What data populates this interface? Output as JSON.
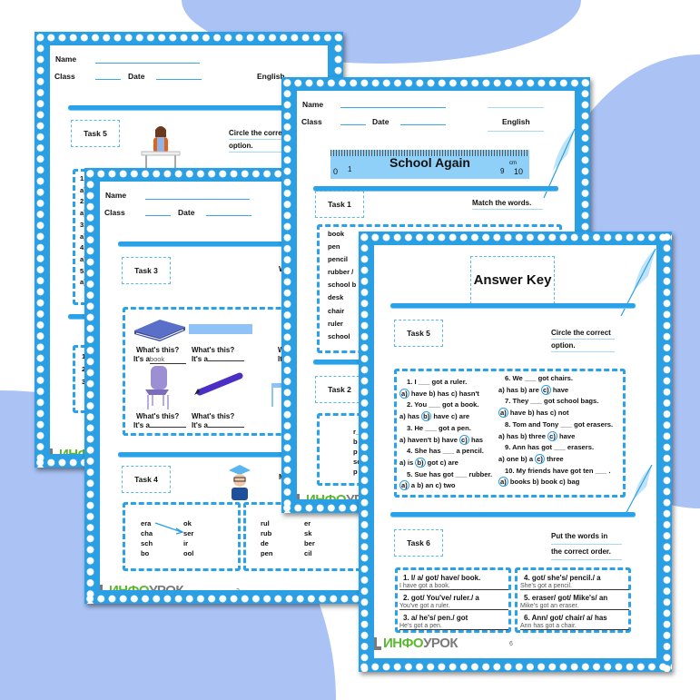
{
  "colors": {
    "border": "#2a9fe4",
    "accent": "#2aa2ea",
    "background_blob": "#aac3f4",
    "logo_green": "#5cb82e",
    "logo_gray": "#7a7a7a"
  },
  "header": {
    "name_label": "Name",
    "class_label": "Class",
    "date_label": "Date",
    "subject": "English"
  },
  "logo": {
    "part1": "ИНФО",
    "part2": "УРОК"
  },
  "page_task5_sheet": {
    "task": "Task 5",
    "instruction": [
      "Circle the correct",
      "option."
    ],
    "items": [
      "1.",
      "a)",
      "2.",
      "a)",
      "3.",
      "a)",
      "4.",
      "a)",
      "5.",
      "a)"
    ],
    "task_below_items": [
      "1",
      "2",
      "3"
    ]
  },
  "page_tasks34": {
    "task3": "Task 3",
    "task3_instruction": "W",
    "pictures": [
      {
        "icon": "book-icon",
        "q": "What's this?",
        "a": "It's a",
        "answer": "book"
      },
      {
        "icon": "ruler-icon",
        "q": "What's this?",
        "a": "It's a",
        "answer": ""
      },
      {
        "icon": "chair-icon",
        "q": "What's this?",
        "a": "It's a",
        "answer": ""
      },
      {
        "icon": "pencil-icon",
        "q": "What's this?",
        "a": "It's a",
        "answer": ""
      }
    ],
    "third_col": {
      "q": "W",
      "a": "It"
    },
    "task4": "Task 4",
    "task4_instruction": "M",
    "match_left": {
      "starts": [
        "era",
        "cha",
        "sch",
        "bo"
      ],
      "ends": [
        "ok",
        "ser",
        "ir",
        "ool"
      ]
    },
    "match_right": {
      "starts": [
        "rul",
        "rub",
        "de",
        "pen"
      ],
      "ends": [
        "er",
        "sk",
        "ber",
        "cil"
      ]
    },
    "page_number": "2"
  },
  "page_school_again": {
    "title": "School Again",
    "ruler_numbers": [
      "0",
      "1",
      "9",
      "10"
    ],
    "ruler_unit": "cm",
    "task1": "Task 1",
    "task1_instruction": "Match the words.",
    "words": [
      "book",
      "pen",
      "pencil",
      "rubber / ",
      "school b",
      "desk",
      "chair",
      "ruler",
      "school"
    ],
    "task2": "Task 2",
    "task2_letters": [
      "r_",
      "b",
      "p",
      "sc",
      "p"
    ]
  },
  "page_answer_key": {
    "title": "Answer Key",
    "task5": "Task 5",
    "task5_instruction": [
      "Circle the correct",
      "option."
    ],
    "questions": [
      {
        "q": "1. I ___ got a ruler.",
        "opts": [
          "a)",
          "have",
          "b)",
          "has",
          "c)",
          "hasn't"
        ],
        "answer": 0
      },
      {
        "q": "2. You ___ got a book.",
        "opts": [
          "a)",
          "has",
          "b)",
          "have",
          "c)",
          "are"
        ],
        "answer": 1
      },
      {
        "q": "3. He ___ got a pen.",
        "opts": [
          "a)",
          "haven't",
          "b)",
          "have",
          "c)",
          "has"
        ],
        "answer": 2
      },
      {
        "q": "4. She has ___ a pencil.",
        "opts": [
          "a)",
          "is",
          "b)",
          "got",
          "c)",
          "are"
        ],
        "answer": 1
      },
      {
        "q": "5. Sue has got ___ rubber.",
        "opts": [
          "a)",
          "a",
          "b)",
          "an",
          "c)",
          "two"
        ],
        "answer": 0
      },
      {
        "q": "6. We ___ got chairs.",
        "opts": [
          "a)",
          "has",
          "b)",
          "are",
          "c)",
          "have"
        ],
        "answer": 2
      },
      {
        "q": "7. They ___ got school bags.",
        "opts": [
          "a)",
          "have",
          "b)",
          "has",
          "c)",
          "not"
        ],
        "answer": 0
      },
      {
        "q": "8. Tom and Tony ___ got erasers.",
        "opts": [
          "a)",
          "has",
          "b)",
          "three",
          "c)",
          "have"
        ],
        "answer": 2
      },
      {
        "q": "9. Ann has got ___ erasers.",
        "opts": [
          "a)",
          "one",
          "b)",
          "a",
          "c)",
          "three"
        ],
        "answer": 2
      },
      {
        "q": "10. My friends have got ten ___ .",
        "opts": [
          "a)",
          "books",
          "b)",
          "book",
          "c)",
          "bag"
        ],
        "answer": 0
      }
    ],
    "task6": "Task 6",
    "task6_instruction": [
      "Put the words in",
      "the correct order."
    ],
    "order": [
      {
        "q": "1. I/ a/ got/ have/ book.",
        "a": "I have got a book."
      },
      {
        "q": "2. got/ You've/ ruler./ a",
        "a": "You've got a ruler."
      },
      {
        "q": "3. a/ he's/ pen./ got",
        "a": "He's got a pen."
      },
      {
        "q": "4. got/ she's/ pencil./ a",
        "a": "She's got a pencil."
      },
      {
        "q": "5. eraser/ got/ Mike's/ an",
        "a": "Mike's got an eraser."
      },
      {
        "q": "6. Ann/ got/ chair/ a/ has",
        "a": "Ann has got a chair."
      }
    ],
    "page_number": "6"
  }
}
